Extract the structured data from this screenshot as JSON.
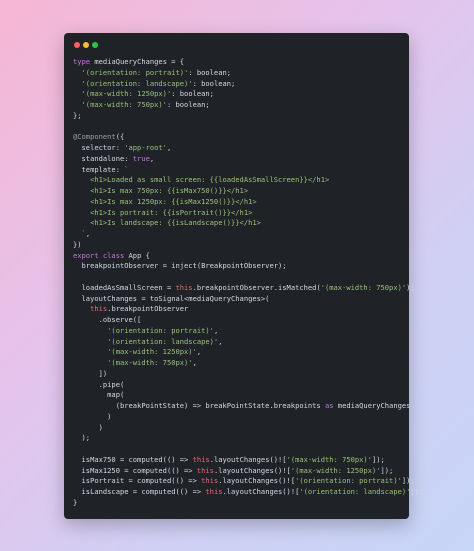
{
  "window": {
    "traffic_lights": [
      {
        "name": "close",
        "color": "#ff5f56"
      },
      {
        "name": "minimize",
        "color": "#ffbd2e"
      },
      {
        "name": "maximize",
        "color": "#27c93f"
      }
    ]
  },
  "code_lines": [
    [
      {
        "t": "keyword",
        "s": "type "
      },
      {
        "t": "ident",
        "s": "mediaQueryChanges = {"
      }
    ],
    [
      {
        "t": "string",
        "s": "  '(orientation: portrait)'"
      },
      {
        "t": "ident",
        "s": ": boolean;"
      }
    ],
    [
      {
        "t": "string",
        "s": "  '(orientation: landscape)'"
      },
      {
        "t": "ident",
        "s": ": boolean;"
      }
    ],
    [
      {
        "t": "string",
        "s": "  '(max-width: 1250px)'"
      },
      {
        "t": "ident",
        "s": ": boolean;"
      }
    ],
    [
      {
        "t": "string",
        "s": "  '(max-width: 750px)'"
      },
      {
        "t": "ident",
        "s": ": boolean;"
      }
    ],
    [
      {
        "t": "ident",
        "s": "};"
      }
    ],
    [
      {
        "t": "ident",
        "s": ""
      }
    ],
    [
      {
        "t": "decor",
        "s": "@Component"
      },
      {
        "t": "ident",
        "s": "({"
      }
    ],
    [
      {
        "t": "ident",
        "s": "  selector: "
      },
      {
        "t": "string",
        "s": "'app-root'"
      },
      {
        "t": "ident",
        "s": ","
      }
    ],
    [
      {
        "t": "ident",
        "s": "  standalone: "
      },
      {
        "t": "keyword",
        "s": "true"
      },
      {
        "t": "ident",
        "s": ","
      }
    ],
    [
      {
        "t": "ident",
        "s": "  template: "
      },
      {
        "t": "string",
        "s": "`"
      }
    ],
    [
      {
        "t": "string",
        "s": "    <h1>Loaded as small screen: {{loadedAsSmallScreen}}</h1>"
      }
    ],
    [
      {
        "t": "string",
        "s": "    <h1>Is max 750px: {{isMax750()}}</h1>"
      }
    ],
    [
      {
        "t": "string",
        "s": "    <h1>Is max 1250px: {{isMax1250()}}</h1>"
      }
    ],
    [
      {
        "t": "string",
        "s": "    <h1>Is portrait: {{isPortrait()}}</h1>"
      }
    ],
    [
      {
        "t": "string",
        "s": "    <h1>Is landscape: {{isLandscape()}}</h1>"
      }
    ],
    [
      {
        "t": "string",
        "s": "  `"
      },
      {
        "t": "ident",
        "s": ","
      }
    ],
    [
      {
        "t": "ident",
        "s": "})"
      }
    ],
    [
      {
        "t": "keyword",
        "s": "export class "
      },
      {
        "t": "ident",
        "s": "App {"
      }
    ],
    [
      {
        "t": "ident",
        "s": "  breakpointObserver = inject(BreakpointObserver);"
      }
    ],
    [
      {
        "t": "ident",
        "s": ""
      }
    ],
    [
      {
        "t": "ident",
        "s": "  loadedAsSmallScreen = "
      },
      {
        "t": "this",
        "s": "this"
      },
      {
        "t": "ident",
        "s": ".breakpointObserver.isMatched("
      },
      {
        "t": "string",
        "s": "'(max-width: 750px)'"
      },
      {
        "t": "ident",
        "s": ");"
      }
    ],
    [
      {
        "t": "ident",
        "s": "  layoutChanges = toSignal<mediaQueryChanges>("
      }
    ],
    [
      {
        "t": "this",
        "s": "    this"
      },
      {
        "t": "ident",
        "s": ".breakpointObserver"
      }
    ],
    [
      {
        "t": "ident",
        "s": "      .observe(["
      }
    ],
    [
      {
        "t": "string",
        "s": "        '(orientation: portrait)'"
      },
      {
        "t": "ident",
        "s": ","
      }
    ],
    [
      {
        "t": "string",
        "s": "        '(orientation: landscape)'"
      },
      {
        "t": "ident",
        "s": ","
      }
    ],
    [
      {
        "t": "string",
        "s": "        '(max-width: 1250px)'"
      },
      {
        "t": "ident",
        "s": ","
      }
    ],
    [
      {
        "t": "string",
        "s": "        '(max-width: 750px)'"
      },
      {
        "t": "ident",
        "s": ","
      }
    ],
    [
      {
        "t": "ident",
        "s": "      ])"
      }
    ],
    [
      {
        "t": "ident",
        "s": "      .pipe("
      }
    ],
    [
      {
        "t": "ident",
        "s": "        map("
      }
    ],
    [
      {
        "t": "ident",
        "s": "          (breakPointState) => breakPointState.breakpoints "
      },
      {
        "t": "keyword",
        "s": "as"
      },
      {
        "t": "ident",
        "s": " mediaQueryChanges"
      }
    ],
    [
      {
        "t": "ident",
        "s": "        )"
      }
    ],
    [
      {
        "t": "ident",
        "s": "      )"
      }
    ],
    [
      {
        "t": "ident",
        "s": "  );"
      }
    ],
    [
      {
        "t": "ident",
        "s": ""
      }
    ],
    [
      {
        "t": "ident",
        "s": "  isMax750 = computed(() => "
      },
      {
        "t": "this",
        "s": "this"
      },
      {
        "t": "ident",
        "s": ".layoutChanges()!["
      },
      {
        "t": "string",
        "s": "'(max-width: 750px)'"
      },
      {
        "t": "ident",
        "s": "]);"
      }
    ],
    [
      {
        "t": "ident",
        "s": "  isMax1250 = computed(() => "
      },
      {
        "t": "this",
        "s": "this"
      },
      {
        "t": "ident",
        "s": ".layoutChanges()!["
      },
      {
        "t": "string",
        "s": "'(max-width: 1250px)'"
      },
      {
        "t": "ident",
        "s": "]);"
      }
    ],
    [
      {
        "t": "ident",
        "s": "  isPortrait = computed(() => "
      },
      {
        "t": "this",
        "s": "this"
      },
      {
        "t": "ident",
        "s": ".layoutChanges()!["
      },
      {
        "t": "string",
        "s": "'(orientation: portrait)'"
      },
      {
        "t": "ident",
        "s": "]);"
      }
    ],
    [
      {
        "t": "ident",
        "s": "  isLandscape = computed(() => "
      },
      {
        "t": "this",
        "s": "this"
      },
      {
        "t": "ident",
        "s": ".layoutChanges()!["
      },
      {
        "t": "string",
        "s": "'(orientation: landscape)'"
      },
      {
        "t": "ident",
        "s": "]);"
      }
    ],
    [
      {
        "t": "ident",
        "s": "}"
      }
    ]
  ]
}
